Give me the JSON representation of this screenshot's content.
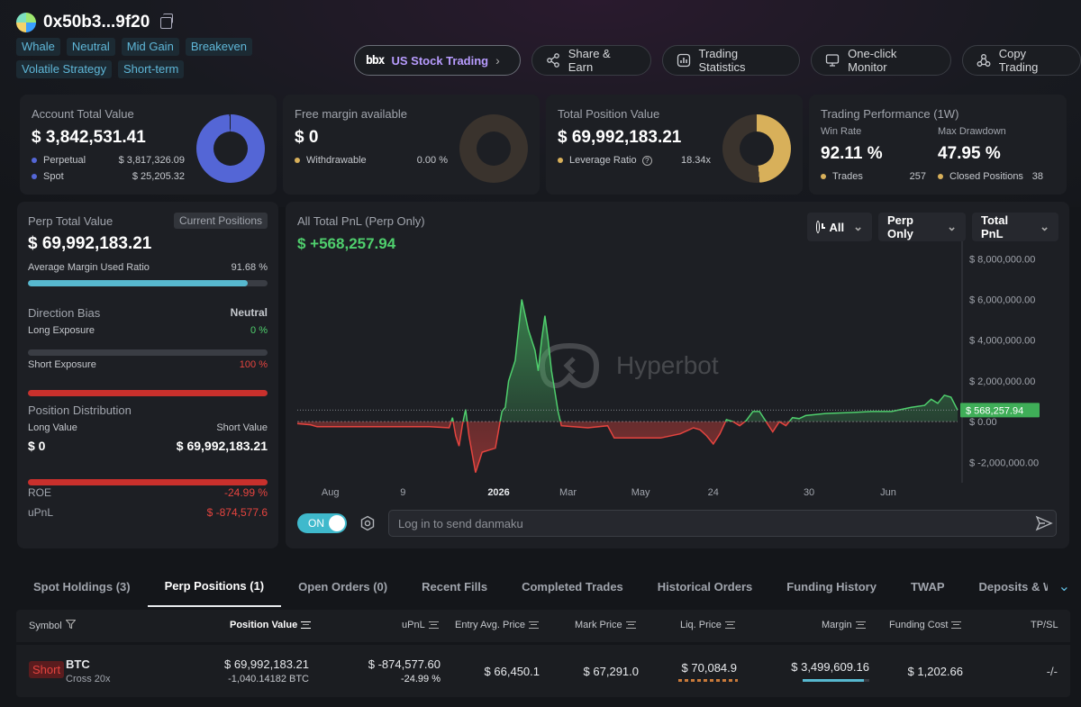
{
  "header": {
    "address": "0x50b3...9f20",
    "tags": [
      "Whale",
      "Neutral",
      "Mid Gain",
      "Breakeven",
      "Volatile Strategy",
      "Short-term"
    ]
  },
  "actions": {
    "stock_logo": "bbx",
    "stock_label": "US Stock Trading",
    "share": "Share & Earn",
    "stats": "Trading Statistics",
    "monitor": "One-click Monitor",
    "copy": "Copy Trading"
  },
  "account": {
    "title": "Account Total Value",
    "value": "$ 3,842,531.41",
    "perpetual_label": "Perpetual",
    "perpetual_value": "$ 3,817,326.09",
    "spot_label": "Spot",
    "spot_value": "$ 25,205.32"
  },
  "margin": {
    "title": "Free margin available",
    "value": "$ 0",
    "withdrawable_label": "Withdrawable",
    "withdrawable_value": "0.00 %"
  },
  "position": {
    "title": "Total Position Value",
    "value": "$ 69,992,183.21",
    "leverage_label": "Leverage Ratio",
    "leverage_value": "18.34x"
  },
  "performance": {
    "title": "Trading Performance (1W)",
    "win_rate_label": "Win Rate",
    "win_rate": "92.11 %",
    "drawdown_label": "Max Drawdown",
    "drawdown": "47.95 %",
    "trades_label": "Trades",
    "trades": "257",
    "closed_label": "Closed Positions",
    "closed": "38"
  },
  "perp": {
    "title": "Perp Total Value",
    "current_positions": "Current Positions",
    "value": "$ 69,992,183.21",
    "margin_ratio_label": "Average Margin Used Ratio",
    "margin_ratio": "91.68 %",
    "margin_ratio_fraction": 0.9168,
    "direction_label": "Direction Bias",
    "direction": "Neutral",
    "long_exposure_label": "Long Exposure",
    "long_exposure": "0 %",
    "short_exposure_label": "Short Exposure",
    "short_exposure": "100 %",
    "short_exposure_fraction": 1.0,
    "distribution_label": "Position Distribution",
    "long_value_label": "Long Value",
    "short_value_label": "Short Value",
    "long_value": "$ 0",
    "short_value": "$ 69,992,183.21",
    "roe_label": "ROE",
    "roe": "-24.99 %",
    "upnl_label": "uPnL",
    "upnl": "$ -874,577.6"
  },
  "pnl_chart": {
    "title": "All Total PnL (Perp Only)",
    "value": "$ +568,257.94",
    "dropdowns": [
      "All",
      "Perp Only",
      "Total PnL"
    ],
    "watermark": "Hyperbot",
    "current_label": "$ 568,257.94",
    "danmaku_placeholder": "Log in to send danmaku",
    "toggle_label": "ON"
  },
  "chart_data": {
    "type": "area",
    "ylim": [
      -3000000,
      8500000
    ],
    "yticks": [
      {
        "label": "$ 8,000,000.00",
        "value": 8000000
      },
      {
        "label": "$ 6,000,000.00",
        "value": 6000000
      },
      {
        "label": "$ 4,000,000.00",
        "value": 4000000
      },
      {
        "label": "$ 2,000,000.00",
        "value": 2000000
      },
      {
        "label": "$ 0.00",
        "value": 0
      },
      {
        "label": "$ -2,000,000.00",
        "value": -2000000
      }
    ],
    "xticks": [
      {
        "label": "Aug",
        "pos": 0.05
      },
      {
        "label": "9",
        "pos": 0.16
      },
      {
        "label": "2026",
        "pos": 0.305
      },
      {
        "label": "Mar",
        "pos": 0.41
      },
      {
        "label": "May",
        "pos": 0.52
      },
      {
        "label": "24",
        "pos": 0.63
      },
      {
        "label": "30",
        "pos": 0.775
      },
      {
        "label": "Jun",
        "pos": 0.895
      }
    ],
    "series": [
      {
        "values": [
          [
            0.0,
            -100000
          ],
          [
            0.02,
            -150000
          ],
          [
            0.03,
            -250000
          ],
          [
            0.06,
            -250000
          ],
          [
            0.1,
            -250000
          ],
          [
            0.15,
            -250000
          ],
          [
            0.2,
            -250000
          ],
          [
            0.23,
            -300000
          ],
          [
            0.235,
            200000
          ],
          [
            0.24,
            -700000
          ],
          [
            0.245,
            -1200000
          ],
          [
            0.25,
            -150000
          ],
          [
            0.255,
            600000
          ],
          [
            0.26,
            -700000
          ],
          [
            0.27,
            -2500000
          ],
          [
            0.28,
            -1500000
          ],
          [
            0.29,
            -1400000
          ],
          [
            0.3,
            -1300000
          ],
          [
            0.31,
            500000
          ],
          [
            0.315,
            700000
          ],
          [
            0.32,
            2000000
          ],
          [
            0.33,
            3000000
          ],
          [
            0.34,
            6000000
          ],
          [
            0.35,
            4500000
          ],
          [
            0.36,
            3500000
          ],
          [
            0.365,
            2500000
          ],
          [
            0.37,
            4000000
          ],
          [
            0.375,
            5200000
          ],
          [
            0.38,
            4000000
          ],
          [
            0.385,
            2500000
          ],
          [
            0.39,
            1500000
          ],
          [
            0.395,
            500000
          ],
          [
            0.4,
            -200000
          ],
          [
            0.44,
            -300000
          ],
          [
            0.47,
            -200000
          ],
          [
            0.48,
            -800000
          ],
          [
            0.5,
            -800000
          ],
          [
            0.55,
            -800000
          ],
          [
            0.58,
            -600000
          ],
          [
            0.6,
            -300000
          ],
          [
            0.61,
            -400000
          ],
          [
            0.62,
            -700000
          ],
          [
            0.63,
            -1100000
          ],
          [
            0.64,
            -600000
          ],
          [
            0.65,
            100000
          ],
          [
            0.66,
            0
          ],
          [
            0.67,
            -200000
          ],
          [
            0.68,
            50000
          ],
          [
            0.69,
            500000
          ],
          [
            0.7,
            500000
          ],
          [
            0.71,
            0
          ],
          [
            0.72,
            -500000
          ],
          [
            0.73,
            0
          ],
          [
            0.74,
            -200000
          ],
          [
            0.75,
            200000
          ],
          [
            0.76,
            150000
          ],
          [
            0.77,
            300000
          ],
          [
            0.8,
            400000
          ],
          [
            0.84,
            450000
          ],
          [
            0.87,
            500000
          ],
          [
            0.9,
            500000
          ],
          [
            0.93,
            700000
          ],
          [
            0.95,
            800000
          ],
          [
            0.96,
            1100000
          ],
          [
            0.97,
            900000
          ],
          [
            0.98,
            1300000
          ],
          [
            0.99,
            1200000
          ],
          [
            1.0,
            568257.94
          ]
        ]
      }
    ],
    "current": 568257.94,
    "grid": false
  },
  "tabs": [
    "Spot Holdings (3)",
    "Perp Positions (1)",
    "Open Orders (0)",
    "Recent Fills",
    "Completed Trades",
    "Historical Orders",
    "Funding History",
    "TWAP",
    "Deposits & Withdraw"
  ],
  "table": {
    "headers": {
      "symbol": "Symbol",
      "position_value": "Position Value",
      "upnl": "uPnL",
      "entry": "Entry Avg. Price",
      "mark": "Mark Price",
      "liq": "Liq. Price",
      "margin": "Margin",
      "funding": "Funding Cost",
      "tpsl": "TP/SL"
    },
    "row": {
      "side": "Short",
      "symbol": "BTC",
      "mode": "Cross 20x",
      "position_value": "$ 69,992,183.21",
      "position_size": "-1,040.14182 BTC",
      "upnl": "$ -874,577.60",
      "upnl_pct": "-24.99 %",
      "entry": "$ 66,450.1",
      "mark": "$ 67,291.0",
      "liq": "$ 70,084.9",
      "margin": "$ 3,499,609.16",
      "funding": "$ 1,202.66",
      "tpsl": "-/-"
    }
  },
  "colors": {
    "accent": "#3fb9cc",
    "green": "#4fcf6d",
    "red": "#e5443f",
    "blue": "#5466d6",
    "gold": "#d8b05a"
  }
}
